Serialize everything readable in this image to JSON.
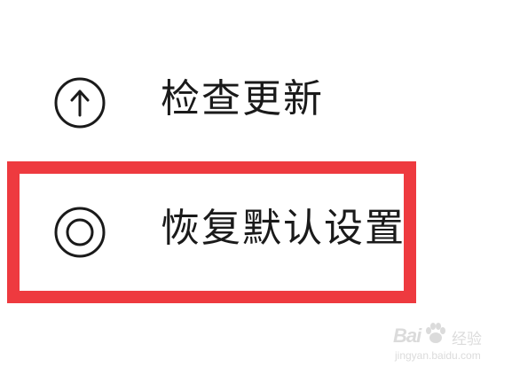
{
  "settings_menu": {
    "items": [
      {
        "label": "检查更新",
        "icon": "arrow-up-circle-icon"
      },
      {
        "label": "恢复默认设置",
        "icon": "radio-target-icon"
      }
    ]
  },
  "highlight": {
    "color": "#ee3a3f",
    "target": "恢复默认设置"
  },
  "watermark": {
    "logo": "Bai",
    "logo_suffix": "经验",
    "url": "jingyan.baidu.com"
  }
}
